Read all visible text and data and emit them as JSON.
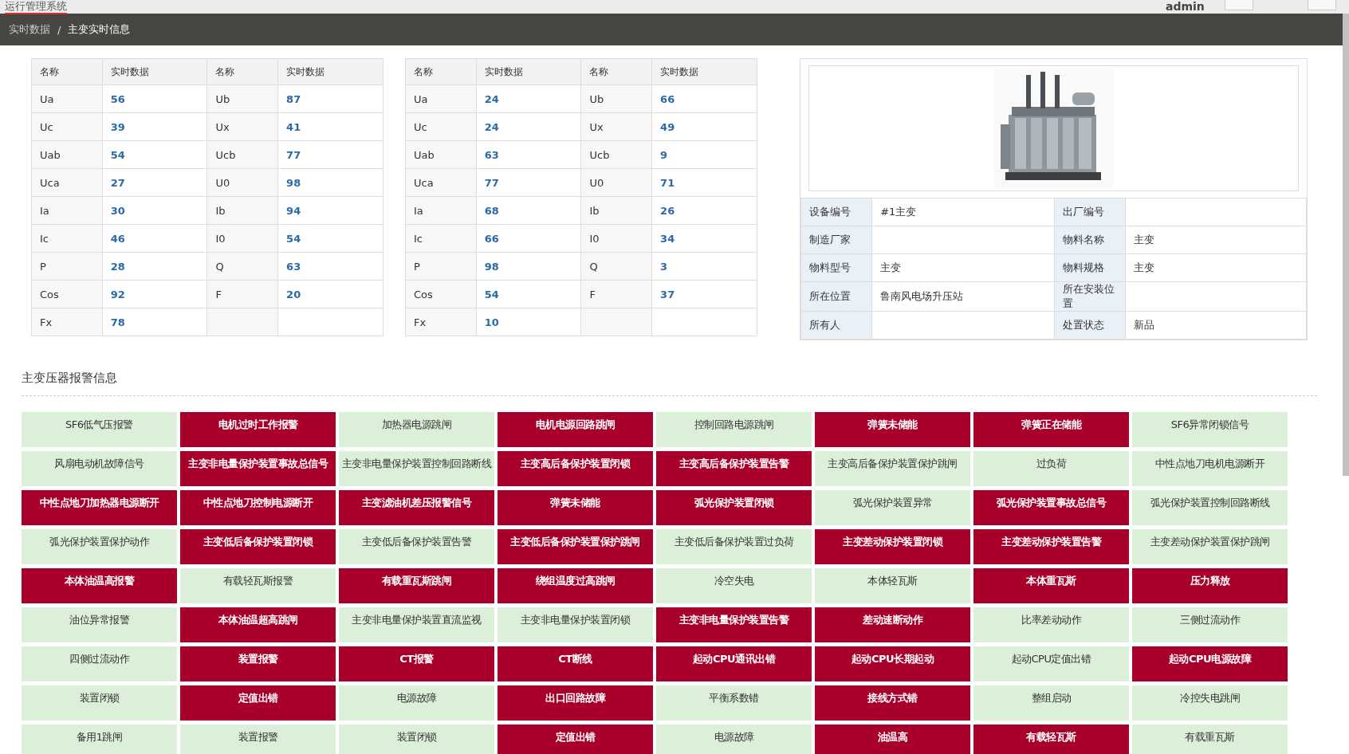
{
  "app_title": "运行管理系统",
  "user": "admin",
  "breadcrumb": [
    "实时数据",
    "/",
    "主变实时信息"
  ],
  "tables": [
    {
      "columns": [
        "名称",
        "实时数据",
        "名称",
        "实时数据"
      ],
      "rows": [
        [
          {
            "name": "Ua",
            "value": "56"
          },
          {
            "name": "Ub",
            "value": "87"
          }
        ],
        [
          {
            "name": "Uc",
            "value": "39"
          },
          {
            "name": "Ux",
            "value": "41"
          }
        ],
        [
          {
            "name": "Uab",
            "value": "54"
          },
          {
            "name": "Ucb",
            "value": "77"
          }
        ],
        [
          {
            "name": "Uca",
            "value": "27"
          },
          {
            "name": "U0",
            "value": "98"
          }
        ],
        [
          {
            "name": "Ia",
            "value": "30"
          },
          {
            "name": "Ib",
            "value": "94"
          }
        ],
        [
          {
            "name": "Ic",
            "value": "46"
          },
          {
            "name": "I0",
            "value": "54"
          }
        ],
        [
          {
            "name": "P",
            "value": "28"
          },
          {
            "name": "Q",
            "value": "63"
          }
        ],
        [
          {
            "name": "Cos",
            "value": "92"
          },
          {
            "name": "F",
            "value": "20"
          }
        ],
        [
          {
            "name": "Fx",
            "value": "78"
          }
        ]
      ]
    },
    {
      "columns": [
        "名称",
        "实时数据",
        "名称",
        "实时数据"
      ],
      "rows": [
        [
          {
            "name": "Ua",
            "value": "24"
          },
          {
            "name": "Ub",
            "value": "66"
          }
        ],
        [
          {
            "name": "Uc",
            "value": "24"
          },
          {
            "name": "Ux",
            "value": "49"
          }
        ],
        [
          {
            "name": "Uab",
            "value": "63"
          },
          {
            "name": "Ucb",
            "value": "9"
          }
        ],
        [
          {
            "name": "Uca",
            "value": "77"
          },
          {
            "name": "U0",
            "value": "71"
          }
        ],
        [
          {
            "name": "Ia",
            "value": "68"
          },
          {
            "name": "Ib",
            "value": "26"
          }
        ],
        [
          {
            "name": "Ic",
            "value": "66"
          },
          {
            "name": "I0",
            "value": "34"
          }
        ],
        [
          {
            "name": "P",
            "value": "98"
          },
          {
            "name": "Q",
            "value": "3"
          }
        ],
        [
          {
            "name": "Cos",
            "value": "54"
          },
          {
            "name": "F",
            "value": "37"
          }
        ],
        [
          {
            "name": "Fx",
            "value": "10"
          }
        ]
      ]
    }
  ],
  "device": {
    "image": {
      "kind": "picture"
    },
    "rows": [
      [
        {
          "label": "设备编号",
          "value": "#1主变"
        },
        {
          "label": "出厂编号"
        }
      ],
      [
        {
          "label": "制造厂家"
        },
        {
          "label": "物料名称",
          "value": "主变"
        }
      ],
      [
        {
          "label": "物料型号",
          "value": "主变"
        },
        {
          "label": "物料规格",
          "value": "主变"
        }
      ],
      [
        {
          "label": "所在位置",
          "value": "鲁南风电场升压站"
        },
        {
          "label": "所在安装位置"
        }
      ],
      [
        {
          "label": "所有人"
        },
        {
          "label": "处置状态",
          "value": "新品"
        }
      ]
    ]
  },
  "alarms": {
    "title": "主变压器报警信息",
    "items": [
      {
        "label": "SF6低气压报警",
        "active": false
      },
      {
        "label": "电机过时工作报警",
        "active": true
      },
      {
        "label": "加热器电源跳闸",
        "active": false
      },
      {
        "label": "电机电源回路跳闸",
        "active": true
      },
      {
        "label": "控制回路电源跳闸",
        "active": false
      },
      {
        "label": "弹簧未储能",
        "active": true
      },
      {
        "label": "弹簧正在储能",
        "active": true
      },
      {
        "label": "SF6异常闭锁信号",
        "active": false
      },
      {
        "label": "风扇电动机故障信号",
        "active": false
      },
      {
        "label": "主变非电量保护装置事故总信号",
        "active": true
      },
      {
        "label": "主变非电量保护装置控制回路断线",
        "active": false
      },
      {
        "label": "主变高后备保护装置闭锁",
        "active": true
      },
      {
        "label": "主变高后备保护装置告警",
        "active": true
      },
      {
        "label": "主变高后备保护装置保护跳闸",
        "active": false
      },
      {
        "label": "过负荷",
        "active": false
      },
      {
        "label": "中性点地刀电机电源断开",
        "active": false
      },
      {
        "label": "中性点地刀加热器电源断开",
        "active": true
      },
      {
        "label": "中性点地刀控制电源断开",
        "active": true
      },
      {
        "label": "主变滤油机差压报警信号",
        "active": true
      },
      {
        "label": "弹簧未储能",
        "active": true
      },
      {
        "label": "弧光保护装置闭锁",
        "active": true
      },
      {
        "label": "弧光保护装置异常",
        "active": false
      },
      {
        "label": "弧光保护装置事故总信号",
        "active": true
      },
      {
        "label": "弧光保护装置控制回路断线",
        "active": false
      },
      {
        "label": "弧光保护装置保护动作",
        "active": false
      },
      {
        "label": "主变低后备保护装置闭锁",
        "active": true
      },
      {
        "label": "主变低后备保护装置告警",
        "active": false
      },
      {
        "label": "主变低后备保护装置保护跳闸",
        "active": true
      },
      {
        "label": "主变低后备保护装置过负荷",
        "active": false
      },
      {
        "label": "主变差动保护装置闭锁",
        "active": true
      },
      {
        "label": "主变差动保护装置告警",
        "active": true
      },
      {
        "label": "主变差动保护装置保护跳闸",
        "active": false
      },
      {
        "label": "本体油温高报警",
        "active": true
      },
      {
        "label": "有载轻瓦斯报警",
        "active": false
      },
      {
        "label": "有载重瓦斯跳闸",
        "active": true
      },
      {
        "label": "绕组温度过高跳闸",
        "active": true
      },
      {
        "label": "冷空失电",
        "active": false
      },
      {
        "label": "本体轻瓦斯",
        "active": false
      },
      {
        "label": "本体重瓦斯",
        "active": true
      },
      {
        "label": "压力释放",
        "active": true
      },
      {
        "label": "油位异常报警",
        "active": false
      },
      {
        "label": "本体油温超高跳闸",
        "active": true
      },
      {
        "label": "主变非电量保护装置直流监视",
        "active": false
      },
      {
        "label": "主变非电量保护装置闭锁",
        "active": false
      },
      {
        "label": "主变非电量保护装置告警",
        "active": true
      },
      {
        "label": "差动速断动作",
        "active": true
      },
      {
        "label": "比率差动动作",
        "active": false
      },
      {
        "label": "三侧过流动作",
        "active": false
      },
      {
        "label": "四侧过流动作",
        "active": false
      },
      {
        "label": "装置报警",
        "active": true
      },
      {
        "label": "CT报警",
        "active": true
      },
      {
        "label": "CT断线",
        "active": true
      },
      {
        "label": "起动CPU通讯出错",
        "active": true
      },
      {
        "label": "起动CPU长期起动",
        "active": true
      },
      {
        "label": "起动CPU定值出错",
        "active": false
      },
      {
        "label": "起动CPU电源故障",
        "active": true
      },
      {
        "label": "装置闭锁",
        "active": false
      },
      {
        "label": "定值出错",
        "active": true
      },
      {
        "label": "电源故障",
        "active": false
      },
      {
        "label": "出口回路故障",
        "active": true
      },
      {
        "label": "平衡系数错",
        "active": false
      },
      {
        "label": "接线方式错",
        "active": true
      },
      {
        "label": "整组启动",
        "active": false
      },
      {
        "label": "冷控失电跳闸",
        "active": false
      },
      {
        "label": "备用1跳闸",
        "active": false
      },
      {
        "label": "装置报警",
        "active": false
      },
      {
        "label": "装置闭锁",
        "active": false
      },
      {
        "label": "定值出错",
        "active": true
      },
      {
        "label": "电源故障",
        "active": false
      },
      {
        "label": "油温高",
        "active": true
      },
      {
        "label": "有载轻瓦斯",
        "active": true
      },
      {
        "label": "有载重瓦斯",
        "active": false
      }
    ]
  }
}
